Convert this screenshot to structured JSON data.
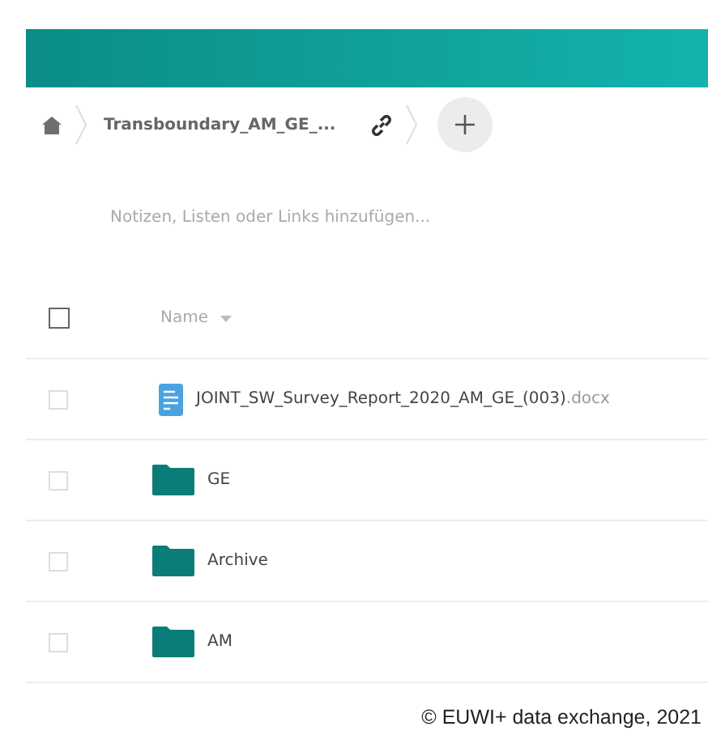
{
  "breadcrumb": {
    "folder": "Transboundary_AM_GE_..."
  },
  "notes": {
    "placeholder": "Notizen, Listen oder Links hinzufügen..."
  },
  "table": {
    "header": {
      "label": "Name",
      "checked": false
    },
    "rows": [
      {
        "kind": "document",
        "name": "JOINT_SW_Survey_Report_2020_AM_GE_(003)",
        "extension": ".docx",
        "checked": false
      },
      {
        "kind": "folder",
        "name": "GE",
        "checked": false
      },
      {
        "kind": "folder",
        "name": "Archive",
        "checked": false
      },
      {
        "kind": "folder",
        "name": "AM",
        "checked": false
      }
    ]
  },
  "caption": "© EUWI+ data exchange, 2021"
}
